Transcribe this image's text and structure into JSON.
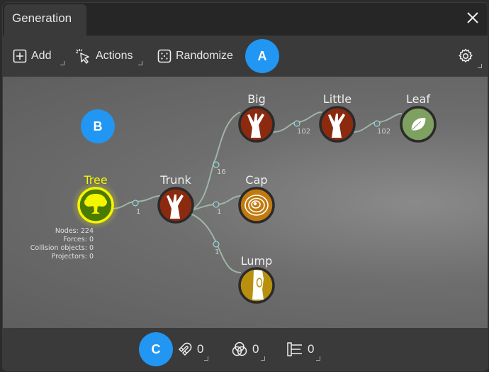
{
  "window": {
    "tab_title": "Generation",
    "close_icon": "close-icon"
  },
  "toolbar": {
    "add_label": "Add",
    "actions_label": "Actions",
    "randomize_label": "Randomize",
    "settings_icon": "gear-icon"
  },
  "badges": {
    "a": "A",
    "b": "B",
    "c": "C"
  },
  "colors": {
    "badge": "#2196f3",
    "selected_node": "#f5f500",
    "tree_fill": "#4a7a00",
    "trunk_fill": "#8c2a10",
    "cap_fill": "#c27a10",
    "lump_fill": "#b8900e",
    "leaf_fill": "#7ea060",
    "edge": "#9fb5a5"
  },
  "graph": {
    "nodes": [
      {
        "id": "tree",
        "label": "Tree",
        "type": "tree",
        "selected": true
      },
      {
        "id": "trunk",
        "label": "Trunk",
        "type": "branch"
      },
      {
        "id": "big",
        "label": "Big",
        "type": "branch"
      },
      {
        "id": "little",
        "label": "Little",
        "type": "branch"
      },
      {
        "id": "leaf",
        "label": "Leaf",
        "type": "leaf"
      },
      {
        "id": "cap",
        "label": "Cap",
        "type": "cap"
      },
      {
        "id": "lump",
        "label": "Lump",
        "type": "lump"
      }
    ],
    "edges": [
      {
        "from": "tree",
        "to": "trunk",
        "count": "1"
      },
      {
        "from": "trunk",
        "to": "big",
        "count": "16"
      },
      {
        "from": "trunk",
        "to": "cap",
        "count": "1"
      },
      {
        "from": "trunk",
        "to": "lump",
        "count": "1"
      },
      {
        "from": "big",
        "to": "little",
        "count": "102"
      },
      {
        "from": "little",
        "to": "leaf",
        "count": "102"
      }
    ]
  },
  "stats": {
    "nodes": "Nodes: 224",
    "forces": "Forces: 0",
    "collision": "Collision objects: 0",
    "projectors": "Projectors: 0"
  },
  "statusbar": {
    "forces_count": "0",
    "collision_count": "0",
    "projectors_count": "0"
  }
}
